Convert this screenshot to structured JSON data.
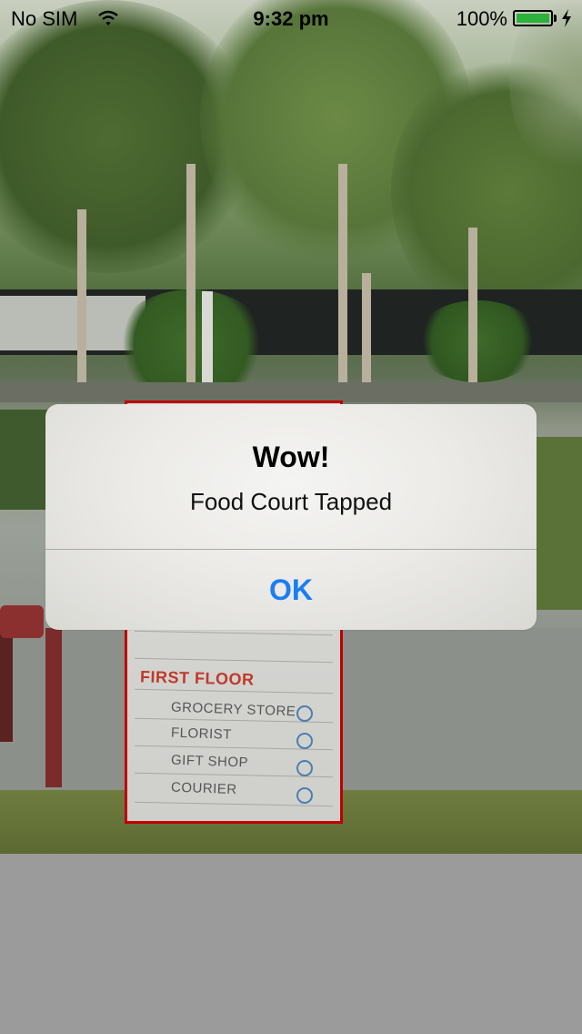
{
  "status_bar": {
    "carrier": "No SIM",
    "time": "9:32 pm",
    "battery_percent": "100%",
    "battery_level": 1.0,
    "battery_color": "#2bb23a",
    "wifi_icon": "wifi-icon",
    "charging_icon": "charging-bolt-icon"
  },
  "signboard": {
    "heading": "FIRST FLOOR",
    "entries": [
      "GROCERY STORE",
      "FLORIST",
      "GIFT SHOP",
      "COURIER"
    ],
    "highlight_color": "#c00000"
  },
  "alert": {
    "title": "Wow!",
    "message": "Food Court Tapped",
    "button_label": "OK",
    "button_color": "#1a7ef2"
  }
}
